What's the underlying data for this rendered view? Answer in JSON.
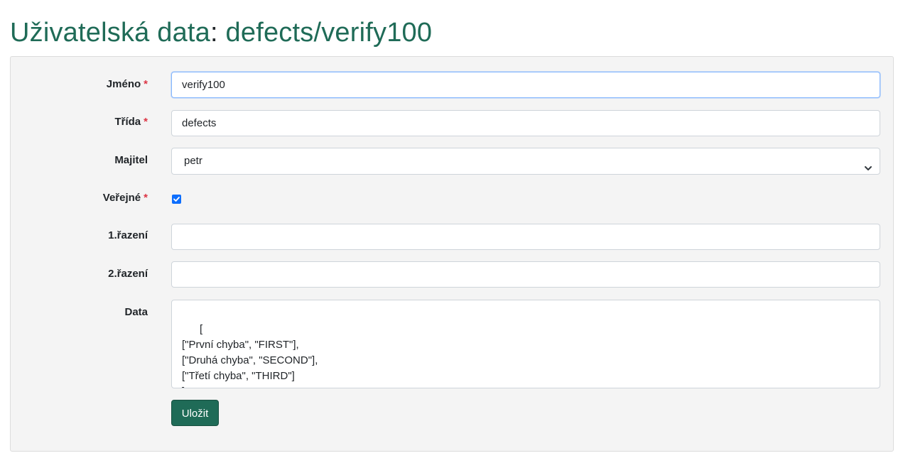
{
  "page": {
    "title_prefix": "Uživatelská data",
    "title_colon": ":",
    "title_path": " defects/verify100"
  },
  "form": {
    "name": {
      "label": "Jméno",
      "required_mark": "*",
      "value": "verify100"
    },
    "class": {
      "label": "Třída",
      "required_mark": "*",
      "value": "defects"
    },
    "owner": {
      "label": "Majitel",
      "selected": "petr"
    },
    "public": {
      "label": "Veřejné",
      "required_mark": "*",
      "checked": true
    },
    "sort1": {
      "label": "1.řazení",
      "value": ""
    },
    "sort2": {
      "label": "2.řazení",
      "value": ""
    },
    "data": {
      "label": "Data",
      "value": "[\n[\"První chyba\", \"FIRST\"],\n[\"Druhá chyba\", \"SECOND\"],\n[\"Třetí chyba\", \"THIRD\"]\n]"
    },
    "save_label": "Uložit"
  },
  "colors": {
    "accent": "#1f6b57",
    "required": "#dc3545",
    "checkbox": "#0d6efd",
    "panel": "#f4f4f4"
  },
  "icons": {
    "select_caret": "chevron-down-icon",
    "checkbox_mark": "check-icon",
    "textarea_resize": "resize-grip-icon"
  }
}
